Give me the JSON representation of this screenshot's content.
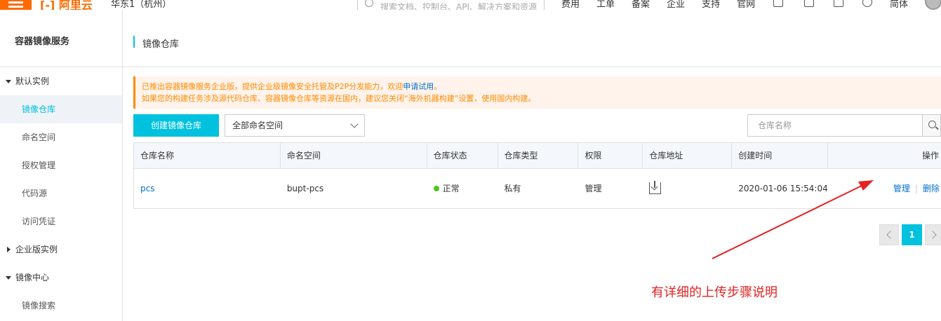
{
  "topbar": {
    "logo": "[-] 阿里云",
    "region": "华东1（杭州）",
    "search_placeholder": "搜索文档、控制台、API、解决方案和资源",
    "links": [
      "费用",
      "工单",
      "备案",
      "企业",
      "支持",
      "官网"
    ],
    "lang": "简体",
    "icons": [
      "grid-icon",
      "bell-icon",
      "cart-icon",
      "help-icon"
    ]
  },
  "sidebar": {
    "title": "容器镜像服务",
    "group_default": "默认实例",
    "items_default": [
      "镜像仓库",
      "命名空间",
      "授权管理",
      "代码源",
      "访问凭证"
    ],
    "group_enterprise": "企业版实例",
    "group_mirror": "镜像中心",
    "items_mirror": [
      "镜像搜索"
    ],
    "active": "镜像仓库"
  },
  "page": {
    "title": "镜像仓库"
  },
  "notice": {
    "line1_prefix": "已推出容器镜像服务企业版，提供企业级镜像安全托管及P2P分发能力，欢迎",
    "line1_link": "申请试用",
    "line1_suffix": "。",
    "line2": "如果您的构建任务涉及源代码仓库、容器镜像仓库等资源在国内，建议您关闭“海外机器构建”设置，使用国内构建。"
  },
  "toolbar": {
    "create_label": "创建镜像仓库",
    "namespace_selected": "全部命名空间",
    "search_placeholder": "仓库名称"
  },
  "table": {
    "headers": [
      "仓库名称",
      "命名空间",
      "仓库状态",
      "仓库类型",
      "权限",
      "仓库地址",
      "创建时间",
      "操作"
    ],
    "rows": [
      {
        "name": "pcs",
        "namespace": "bupt-pcs",
        "status": "正常",
        "type": "私有",
        "permission": "管理",
        "created": "2020-01-06 15:54:04",
        "op_manage": "管理",
        "op_sep": "|",
        "op_delete": "删除"
      }
    ]
  },
  "pagination": {
    "current": "1"
  },
  "annotation": {
    "text": "有详细的上传步骤说明",
    "color": "#e32222"
  },
  "colors": {
    "accent": "#00c1de",
    "brand": "#ff6a00",
    "link": "#0070cc",
    "status_ok": "#52c41a"
  }
}
